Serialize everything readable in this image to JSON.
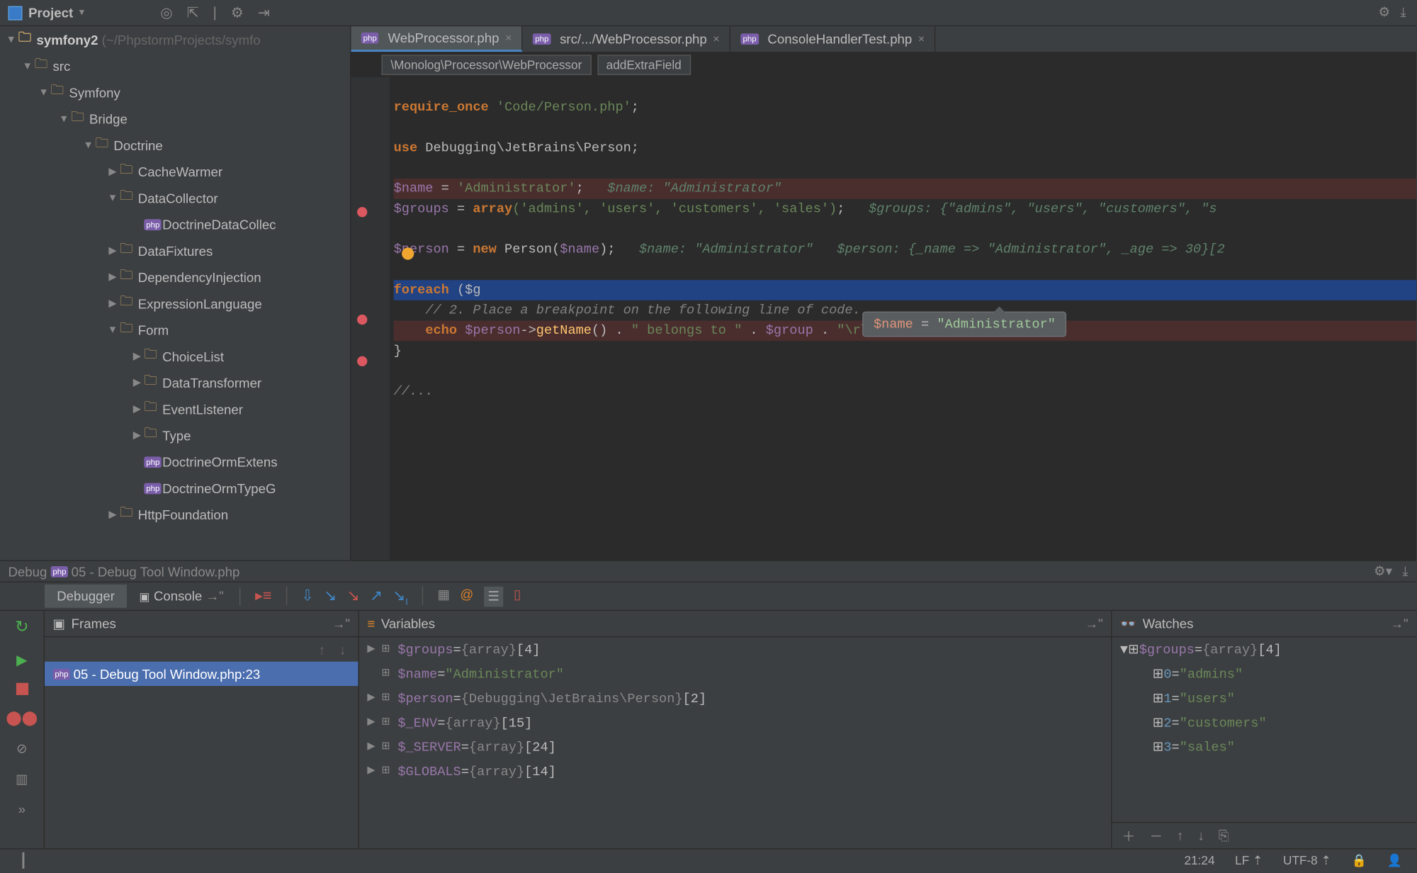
{
  "project": {
    "panel_label": "Project",
    "root_name": "symfony2",
    "root_path": "(~/PhpstormProjects/symfo",
    "tree": [
      {
        "indent": 1,
        "twisty": "▼",
        "type": "folder",
        "label": "src"
      },
      {
        "indent": 2,
        "twisty": "▼",
        "type": "folder",
        "label": "Symfony"
      },
      {
        "indent": 3,
        "twisty": "▼",
        "type": "folder",
        "label": "Bridge"
      },
      {
        "indent": 4,
        "twisty": "▼",
        "type": "folder",
        "label": "Doctrine"
      },
      {
        "indent": 5,
        "twisty": "▶",
        "type": "folder",
        "label": "CacheWarmer"
      },
      {
        "indent": 5,
        "twisty": "▼",
        "type": "folder",
        "label": "DataCollector"
      },
      {
        "indent": 6,
        "twisty": "",
        "type": "php",
        "label": "DoctrineDataCollec"
      },
      {
        "indent": 5,
        "twisty": "▶",
        "type": "folder",
        "label": "DataFixtures"
      },
      {
        "indent": 5,
        "twisty": "▶",
        "type": "folder",
        "label": "DependencyInjection"
      },
      {
        "indent": 5,
        "twisty": "▶",
        "type": "folder",
        "label": "ExpressionLanguage"
      },
      {
        "indent": 5,
        "twisty": "▼",
        "type": "folder",
        "label": "Form"
      },
      {
        "indent": 6,
        "twisty": "▶",
        "type": "folder",
        "label": "ChoiceList"
      },
      {
        "indent": 6,
        "twisty": "▶",
        "type": "folder",
        "label": "DataTransformer"
      },
      {
        "indent": 6,
        "twisty": "▶",
        "type": "folder",
        "label": "EventListener"
      },
      {
        "indent": 6,
        "twisty": "▶",
        "type": "folder",
        "label": "Type"
      },
      {
        "indent": 6,
        "twisty": "",
        "type": "php",
        "label": "DoctrineOrmExtens"
      },
      {
        "indent": 6,
        "twisty": "",
        "type": "php",
        "label": "DoctrineOrmTypeG"
      },
      {
        "indent": 5,
        "twisty": "▶",
        "type": "folder",
        "label": "HttpFoundation"
      }
    ]
  },
  "editor": {
    "tabs": [
      {
        "label": "WebProcessor.php",
        "active": true
      },
      {
        "label": "src/.../WebProcessor.php",
        "active": false
      },
      {
        "label": "ConsoleHandlerTest.php",
        "active": false
      }
    ],
    "breadcrumbs": [
      "\\Monolog\\Processor\\WebProcessor",
      "addExtraField"
    ],
    "tooltip": {
      "var": "$name",
      "val": "\"Administrator\""
    }
  },
  "code": {
    "l1_kw": "require_once",
    "l1_str": "'Code/Person.php'",
    "l2_kw": "use",
    "l2_txt": " Debugging\\JetBrains\\Person;",
    "l3_var": "$name",
    "l3_str": "'Administrator'",
    "l3_hint": "$name: \"Administrator\"",
    "l4_var": "$groups",
    "l4_kw": "array",
    "l4_args": "('admins', 'users', 'customers', 'sales')",
    "l4_hint": "$groups: {\"admins\", \"users\", \"customers\", \"s",
    "l5_var": "$person",
    "l5_kw": "new",
    "l5_cls": "Person",
    "l5_arg": "$name",
    "l5_hint1": "$name: \"Administrator\"",
    "l5_hint2": "$person: {_name => \"Administrator\", _age => 30}[2",
    "l6_kw": "foreach",
    "l6_txt": " ($g",
    "l7_cm": "// 2. Place a breakpoint on the following line of code.",
    "l8_kw": "echo",
    "l8_var": "$person",
    "l8_fn": "getName",
    "l8_str1": "\" belongs to \"",
    "l8_var2": "$group",
    "l8_str2": "\"\\r\\n\"",
    "l9": "}",
    "l10": "//..."
  },
  "debug": {
    "title": "Debug",
    "file_label": "05 - Debug Tool Window.php",
    "tab_debugger": "Debugger",
    "tab_console": "Console",
    "frames_header": "Frames",
    "frame_row": "05 - Debug Tool Window.php:23",
    "variables_header": "Variables",
    "watches_header": "Watches",
    "vars": [
      {
        "tw": "▶",
        "name": "$groups",
        "sep": " = ",
        "type": "{array}",
        "val": " [4]"
      },
      {
        "tw": "",
        "name": "$name",
        "sep": " = ",
        "str": "\"Administrator\""
      },
      {
        "tw": "▶",
        "name": "$person",
        "sep": " = ",
        "type": "{Debugging\\JetBrains\\Person}",
        "val": " [2]"
      },
      {
        "tw": "▶",
        "name": "$_ENV",
        "sep": " = ",
        "type": "{array}",
        "val": " [15]"
      },
      {
        "tw": "▶",
        "name": "$_SERVER",
        "sep": " = ",
        "type": "{array}",
        "val": " [24]"
      },
      {
        "tw": "▶",
        "name": "$GLOBALS",
        "sep": " = ",
        "type": "{array}",
        "val": " [14]"
      }
    ],
    "watches": {
      "root": {
        "tw": "▼",
        "name": "$groups",
        "sep": " = ",
        "type": "{array}",
        "val": " [4]"
      },
      "items": [
        {
          "idx": "0",
          "val": "\"admins\""
        },
        {
          "idx": "1",
          "val": "\"users\""
        },
        {
          "idx": "2",
          "val": "\"customers\""
        },
        {
          "idx": "3",
          "val": "\"sales\""
        }
      ]
    }
  },
  "status": {
    "pos": "21:24",
    "linesep": "LF ⇡",
    "enc": "UTF-8 ⇡",
    "lock": "🔒"
  }
}
